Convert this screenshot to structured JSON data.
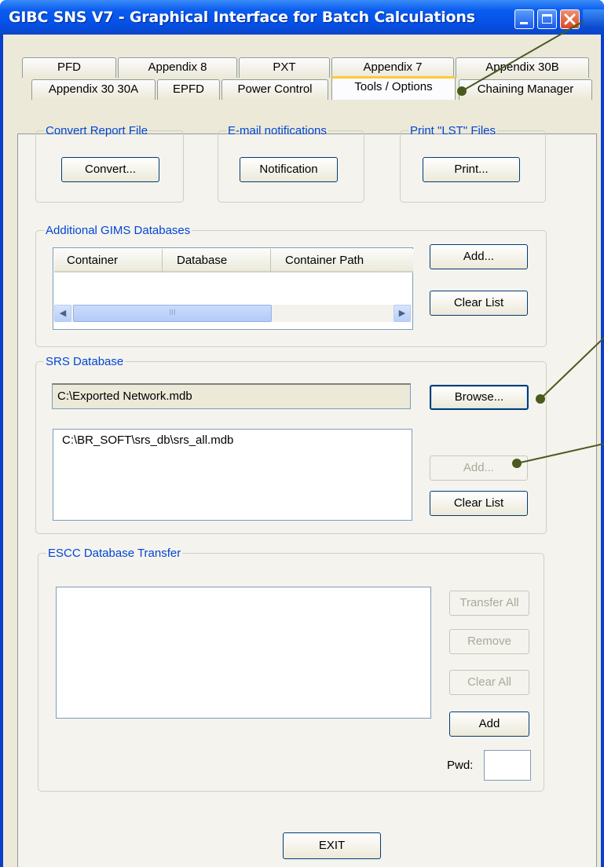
{
  "window": {
    "title": "GIBC SNS V7 - Graphical Interface for Batch Calculations"
  },
  "tabs": {
    "row1": [
      "PFD",
      "Appendix 8",
      "PXT",
      "Appendix 7",
      "Appendix 30B"
    ],
    "row2": [
      "Appendix 30 30A",
      "EPFD",
      "Power Control",
      "Tools / Options",
      "Chaining Manager"
    ],
    "active": "Tools / Options"
  },
  "convert_report": {
    "legend": "Convert Report File",
    "button": "Convert..."
  },
  "email": {
    "legend": "E-mail notifications",
    "button": "Notification"
  },
  "print_lst": {
    "legend": "Print \"LST\" Files",
    "button": "Print..."
  },
  "gims": {
    "legend": "Additional GIMS Databases",
    "columns": [
      "Container",
      "Database",
      "Container Path"
    ],
    "scroll_thumb": "III",
    "add_button": "Add...",
    "clear_button": "Clear List"
  },
  "srs": {
    "legend": "SRS Database",
    "path_value": "C:\\Exported Network.mdb",
    "browse_button": "Browse...",
    "list_items": [
      "C:\\BR_SOFT\\srs_db\\srs_all.mdb"
    ],
    "add_button": "Add...",
    "clear_button": "Clear List"
  },
  "escc": {
    "legend": "ESCC Database Transfer",
    "transfer_all": "Transfer All",
    "remove": "Remove",
    "clear_all": "Clear All",
    "add": "Add",
    "pwd_label": "Pwd:",
    "pwd_value": ""
  },
  "exit_button": "EXIT",
  "colors": {
    "title_blue": "#0a5cf0",
    "legend_blue": "#0046d5",
    "callout": "#4a5a1e",
    "face": "#ece9d8"
  }
}
